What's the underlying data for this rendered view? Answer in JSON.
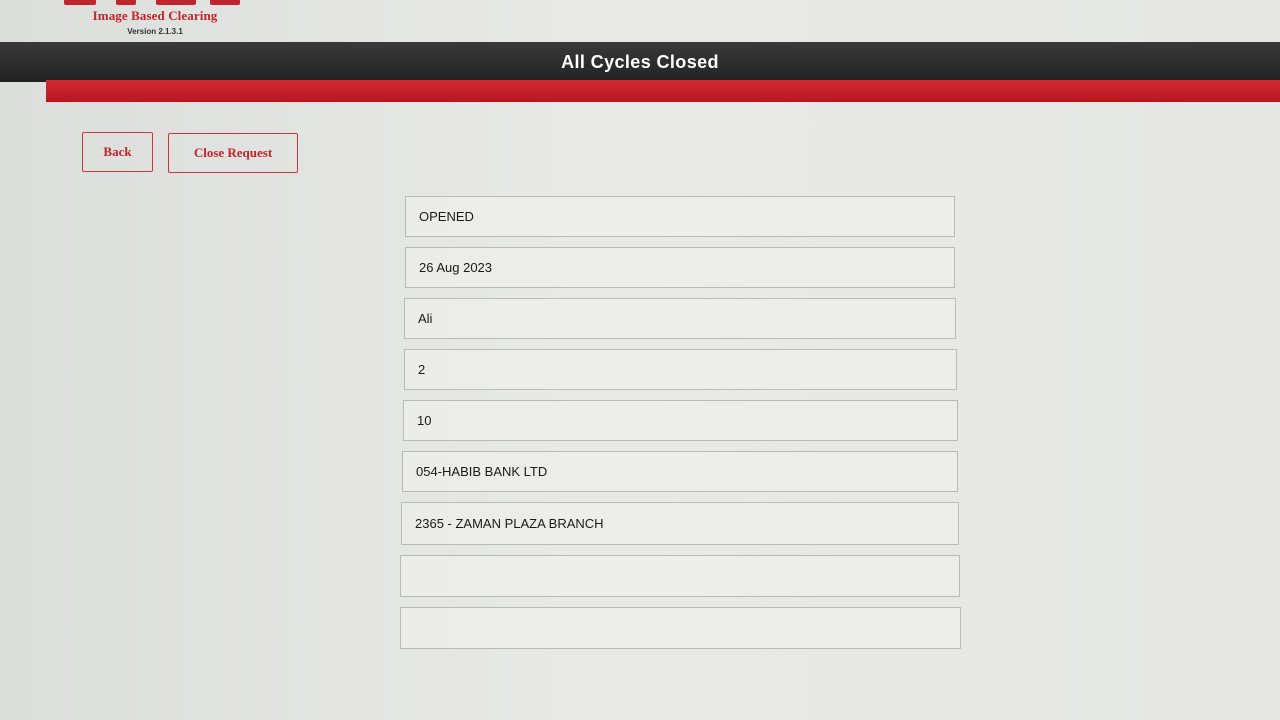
{
  "app": {
    "logo_title": "Image Based Clearing",
    "version": "Version 2.1.3.1"
  },
  "header": {
    "title": "All Cycles Closed"
  },
  "actions": {
    "back_label": "Back",
    "close_request_label": "Close Request"
  },
  "fields": [
    {
      "value": "OPENED"
    },
    {
      "value": "26 Aug 2023"
    },
    {
      "value": "Ali"
    },
    {
      "value": "2"
    },
    {
      "value": "10"
    },
    {
      "value": "054-HABIB BANK LTD"
    },
    {
      "value": "2365 - ZAMAN PLAZA BRANCH"
    },
    {
      "value": ""
    },
    {
      "value": ""
    }
  ],
  "colors": {
    "brand_red": "#c0242c",
    "header_dark": "#2a2a2a"
  }
}
